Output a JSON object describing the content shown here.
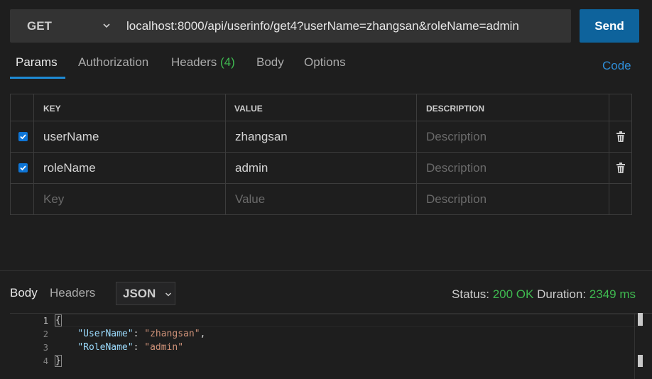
{
  "request": {
    "method": "GET",
    "url": "localhost:8000/api/userinfo/get4?userName=zhangsan&roleName=admin",
    "send_label": "Send"
  },
  "tabs": {
    "params": "Params",
    "authorization": "Authorization",
    "headers": "Headers",
    "headers_count": "(4)",
    "body": "Body",
    "options": "Options",
    "code": "Code"
  },
  "params_table": {
    "headers": {
      "key": "KEY",
      "value": "VALUE",
      "description": "DESCRIPTION"
    },
    "rows": [
      {
        "checked": true,
        "key": "userName",
        "value": "zhangsan",
        "description": "Description"
      },
      {
        "checked": true,
        "key": "roleName",
        "value": "admin",
        "description": "Description"
      }
    ],
    "new_row": {
      "key": "Key",
      "value": "Value",
      "description": "Description"
    }
  },
  "response": {
    "tab_body": "Body",
    "tab_headers": "Headers",
    "format": "JSON",
    "status_label": "Status:",
    "status_value": "200 OK",
    "duration_label": "Duration:",
    "duration_value": "2349 ms",
    "line_numbers": [
      "1",
      "2",
      "3",
      "4"
    ],
    "body": {
      "open": "{",
      "key1": "\"UserName\"",
      "val1": "\"zhangsan\"",
      "key2": "\"RoleName\"",
      "val2": "\"admin\"",
      "close": "}"
    }
  },
  "colors": {
    "accent": "#0e639c",
    "status_ok": "#3fb950",
    "link": "#2f8ed8"
  }
}
